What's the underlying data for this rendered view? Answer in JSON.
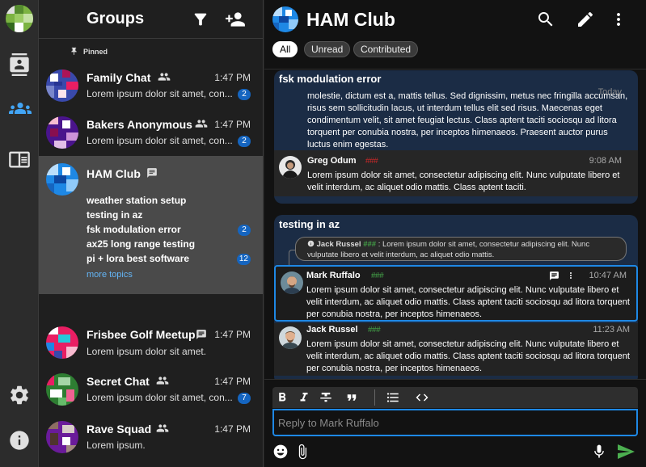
{
  "rail": {
    "items": [
      "contacts",
      "groups",
      "feed",
      "settings",
      "info"
    ]
  },
  "groups_panel": {
    "title": "Groups",
    "pinned_label": "Pinned",
    "groups": [
      {
        "name": "Family Chat",
        "time": "1:47 PM",
        "preview": "Lorem ipsum dolor sit amet, con...",
        "badge": "2",
        "icon": "people-icon"
      },
      {
        "name": "Bakers Anonymous",
        "time": "1:47 PM",
        "preview": "Lorem ipsum dolor sit amet, con...",
        "badge": "2",
        "icon": "people-icon"
      },
      {
        "name": "HAM Club",
        "icon": "chat-icon",
        "topics": [
          {
            "label": "weather station setup",
            "badge": ""
          },
          {
            "label": "testing in az",
            "badge": ""
          },
          {
            "label": "fsk modulation error",
            "badge": "2"
          },
          {
            "label": "ax25 long range testing",
            "badge": ""
          },
          {
            "label": "pi + lora best software",
            "badge": "12"
          }
        ],
        "more": "more topics"
      },
      {
        "name": "Frisbee Golf Meetup",
        "time": "1:47 PM",
        "preview": "Lorem ipsum dolor sit amet.",
        "badge": "",
        "icon": "chat-icon"
      },
      {
        "name": "Secret Chat",
        "time": "1:47 PM",
        "preview": "Lorem ipsum dolor sit amet, con...",
        "badge": "7",
        "icon": "people-icon"
      },
      {
        "name": "Rave Squad",
        "time": "1:47 PM",
        "preview": "Lorem ipsum.",
        "badge": "",
        "icon": "people-icon"
      }
    ]
  },
  "chat": {
    "title": "HAM Club",
    "filters": [
      "All",
      "Unread",
      "Contributed"
    ],
    "active_filter": "All",
    "topic1": {
      "title": "fsk modulation error",
      "hidden_time": "Today",
      "partial_text": "molestie, dictum est a, mattis tellus. Sed dignissim, metus nec fringilla accumsan, risus sem sollicitudin lacus, ut interdum tellus elit sed risus. Maecenas eget condimentum velit, sit amet feugiat lectus. Class aptent taciti sociosqu ad litora torquent per conubia nostra, per inceptos himenaeos. Praesent auctor purus luctus enim egestas.",
      "message": {
        "author": "Greg Odum",
        "hash": "###",
        "hash_color": "#c62828",
        "time": "9:08 AM",
        "text": "Lorem ipsum dolor sit amet, consectetur adipiscing elit. Nunc vulputate libero et velit interdum, ac aliquet odio mattis. Class aptent taciti."
      }
    },
    "topic2": {
      "title": "testing in az",
      "quote": {
        "author": "Jack Russel",
        "hash": "###",
        "text": ": Lorem ipsum dolor sit amet, consectetur adipiscing elit. Nunc vulputate libero et velit interdum, ac aliquet odio mattis."
      },
      "messages": [
        {
          "author": "Mark Ruffalo",
          "hash": "###",
          "hash_color": "#43a047",
          "time": "10:47 AM",
          "text": "Lorem ipsum dolor sit amet, consectetur adipiscing elit. Nunc vulputate libero et velit interdum, ac aliquet odio mattis. Class aptent taciti sociosqu ad litora torquent per conubia nostra, per inceptos himenaeos."
        },
        {
          "author": "Jack Russel",
          "hash": "###",
          "hash_color": "#43a047",
          "time": "11:23 AM",
          "text": "Lorem ipsum dolor sit amet, consectetur adipiscing elit. Nunc vulputate libero et velit interdum, ac aliquet odio mattis. Class aptent taciti sociosqu ad litora torquent per conubia nostra, per inceptos himenaeos."
        }
      ]
    },
    "composer": {
      "placeholder": "Reply to Mark Ruffalo",
      "tools": [
        "bold",
        "italic",
        "strikethrough",
        "quote",
        "bulleted-list",
        "code"
      ]
    }
  },
  "colors": {
    "accent": "#1e88e5",
    "badge": "#1565c0",
    "link": "#64b5f6",
    "topic_bg": "#1b2c45",
    "send": "#4caf50"
  }
}
